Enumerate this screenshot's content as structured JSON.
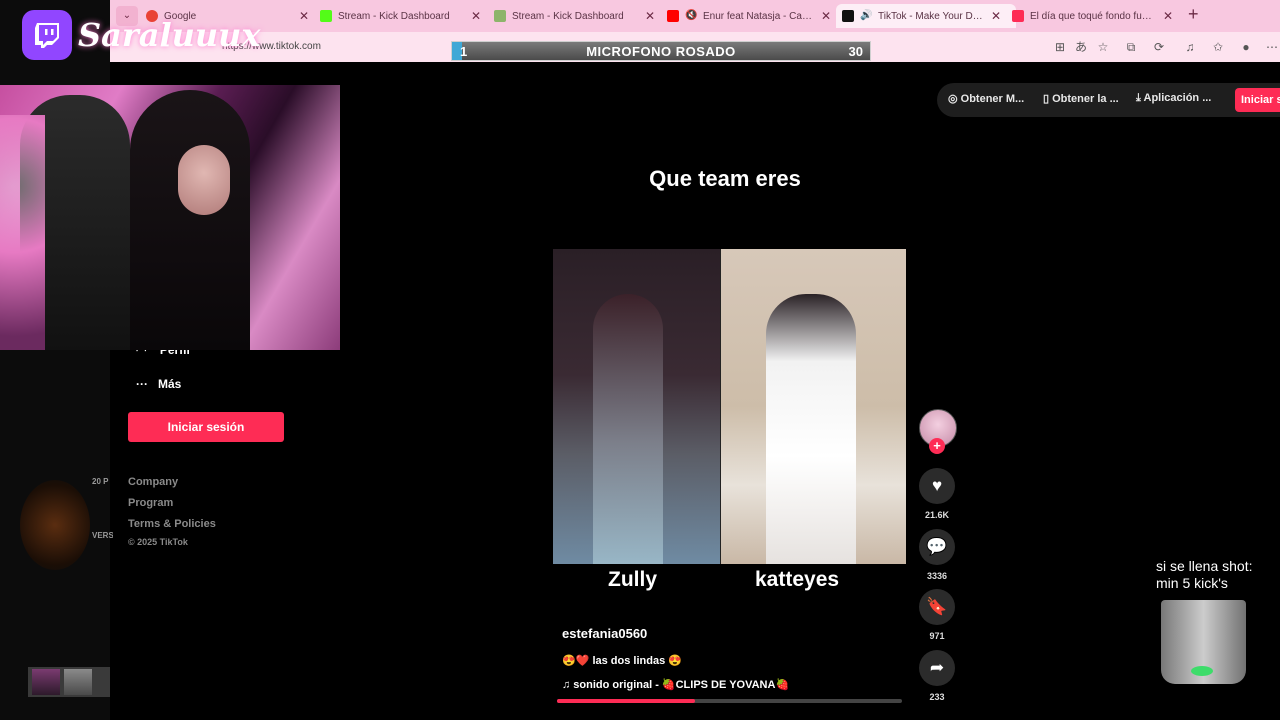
{
  "stream": {
    "channel_name": "Saraluuux",
    "mic_bar": {
      "left_num": "1",
      "title": "MICROFONO ROSADO",
      "right_num": "30"
    },
    "shot_goal": {
      "line1": "si se llena shot:",
      "line2": "min 5 kick's"
    }
  },
  "browser": {
    "tabs": [
      {
        "label": "Google",
        "favicon_color": "#e94235"
      },
      {
        "label": "Stream - Kick Dashboard",
        "favicon_color": "#53fc18"
      },
      {
        "label": "Stream - Kick Dashboard",
        "favicon_color": "#8db46a"
      },
      {
        "label": "Enur feat Natasja - Calabria",
        "favicon_color": "#ff0000"
      },
      {
        "label": "TikTok - Make Your Day",
        "favicon_color": "#111111"
      },
      {
        "label": "El día que toqué fondo fue el d",
        "favicon_color": "#fe2c55"
      }
    ],
    "close_glyph": "✕",
    "new_tab_glyph": "+",
    "url": "https://www.tiktok.com"
  },
  "tiktok": {
    "top_buttons": {
      "coins": "Obtener M...",
      "app": "Obtener la ...",
      "desktop": "Aplicación ...",
      "login": "Iniciar s"
    },
    "nav": {
      "perfil": "Perfil",
      "mas": "Más"
    },
    "login_button": "Iniciar sesión",
    "footer": {
      "company": "Company",
      "program": "Program",
      "terms": "Terms & Policies",
      "copyright": "© 2025 TikTok"
    },
    "video": {
      "title": "Que team eres",
      "left_name": "Zully",
      "right_name": "katteyes",
      "author": "estefania0560",
      "description": "😍❤️ las dos lindas 😍",
      "music": "♫  sonido original - 🍓CLIPS DE YOVANA🍓",
      "progress": 0.4
    },
    "actions": {
      "likes": "21.6K",
      "comments": "3336",
      "saves": "971",
      "shares": "233"
    }
  },
  "left_ui": {
    "badge": "20 P",
    "version": "VERS"
  },
  "colors": {
    "tiktok_red": "#fe2c55",
    "twitch_purple": "#9146ff",
    "tab_bar": "#f8c8e0"
  }
}
